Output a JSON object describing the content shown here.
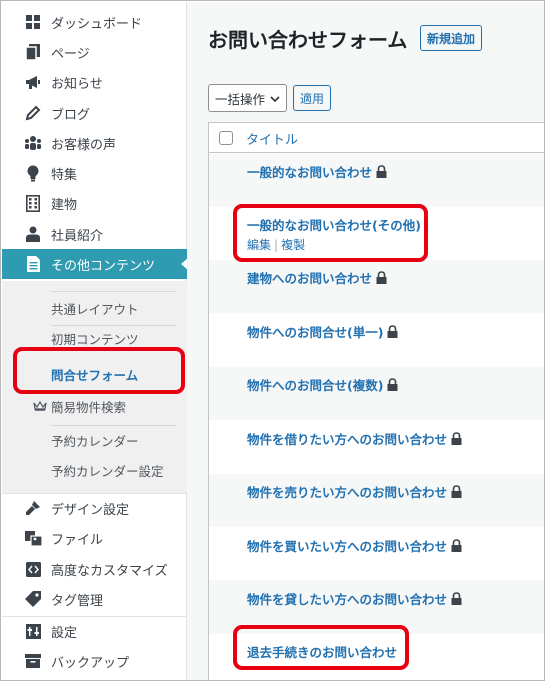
{
  "sidebar": {
    "items": [
      {
        "label": "ダッシュボード",
        "icon": "dashboard-icon"
      },
      {
        "label": "ページ",
        "icon": "page-icon"
      },
      {
        "label": "お知らせ",
        "icon": "megaphone-icon"
      },
      {
        "label": "ブログ",
        "icon": "pencil-icon"
      },
      {
        "label": "お客様の声",
        "icon": "groups-icon"
      },
      {
        "label": "特集",
        "icon": "lightbulb-icon"
      },
      {
        "label": "建物",
        "icon": "building-icon"
      },
      {
        "label": "社員紹介",
        "icon": "person-icon"
      },
      {
        "label": "その他コンテンツ",
        "icon": "document-icon"
      },
      {
        "label": "デザイン設定",
        "icon": "brush-icon"
      },
      {
        "label": "ファイル",
        "icon": "media-icon"
      },
      {
        "label": "高度なカスタマイズ",
        "icon": "code-icon"
      },
      {
        "label": "タグ管理",
        "icon": "tag-icon"
      },
      {
        "label": "設定",
        "icon": "settings-icon"
      },
      {
        "label": "バックアップ",
        "icon": "archive-icon"
      }
    ],
    "submenu": [
      {
        "label": "共通レイアウト"
      },
      {
        "label": "初期コンテンツ"
      },
      {
        "label": "問合せフォーム"
      },
      {
        "label": "簡易物件検索",
        "icon": "crown-icon"
      },
      {
        "label": "予約カレンダー"
      },
      {
        "label": "予約カレンダー設定"
      }
    ]
  },
  "main": {
    "title": "お問い合わせフォーム",
    "add_new": "新規追加",
    "bulk_action": "一括操作",
    "apply": "適用",
    "column_title": "タイトル",
    "row_actions": {
      "edit": "編集",
      "separator": "|",
      "duplicate": "複製"
    },
    "rows": [
      {
        "title": "一般的なお問い合わせ",
        "locked": true
      },
      {
        "title": "一般的なお問い合わせ(その他)",
        "locked": false
      },
      {
        "title": "建物へのお問い合わせ",
        "locked": true
      },
      {
        "title": "物件へのお問合せ(単一)",
        "locked": true
      },
      {
        "title": "物件へのお問合せ(複数)",
        "locked": true
      },
      {
        "title": "物件を借りたい方へのお問い合わせ",
        "locked": true
      },
      {
        "title": "物件を売りたい方へのお問い合わせ",
        "locked": true
      },
      {
        "title": "物件を買いたい方へのお問い合わせ",
        "locked": true
      },
      {
        "title": "物件を貸したい方へのお問い合わせ",
        "locked": true
      },
      {
        "title": "退去手続きのお問い合わせ",
        "locked": false
      }
    ]
  },
  "colors": {
    "accent": "#2271b1",
    "menu_active": "#2f9bb0",
    "highlight": "#e60012"
  }
}
